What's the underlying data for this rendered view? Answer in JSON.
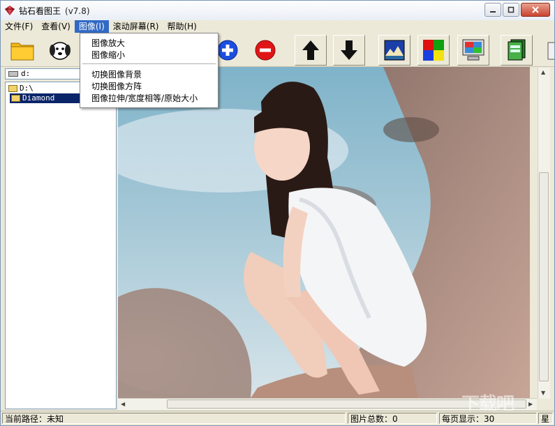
{
  "window": {
    "title": "钻石看图王",
    "version": "(v7.8)"
  },
  "menubar": {
    "items": [
      "文件(F)",
      "查看(V)",
      "图像(I)",
      "滚动屏幕(R)",
      "帮助(H)"
    ],
    "active_index": 2
  },
  "image_menu": {
    "items": [
      "图像放大",
      "图像缩小",
      "切换图像背景",
      "切换图像方阵",
      "图像拉伸/宽度相等/原始大小"
    ]
  },
  "toolbar": {
    "buttons": [
      "open-folder-icon",
      "dog-icon",
      "zoom-in-icon",
      "zoom-out-icon",
      "up-arrow-icon",
      "down-arrow-icon",
      "landscape-icon",
      "color-grid-icon",
      "monitor-icon",
      "label-pages-icon"
    ]
  },
  "drive": {
    "label": "d:"
  },
  "tree": {
    "items": [
      "D:\\",
      "Diamond"
    ],
    "selected_index": 1
  },
  "status": {
    "path": "当前路径：未知",
    "total": "图片总数：0",
    "per_page": "每页显示：30",
    "extra": "星"
  },
  "watermark": "下载吧",
  "colors": {
    "selection": "#0a246a",
    "menu_active": "#316ac5",
    "chrome": "#ece9d8"
  }
}
